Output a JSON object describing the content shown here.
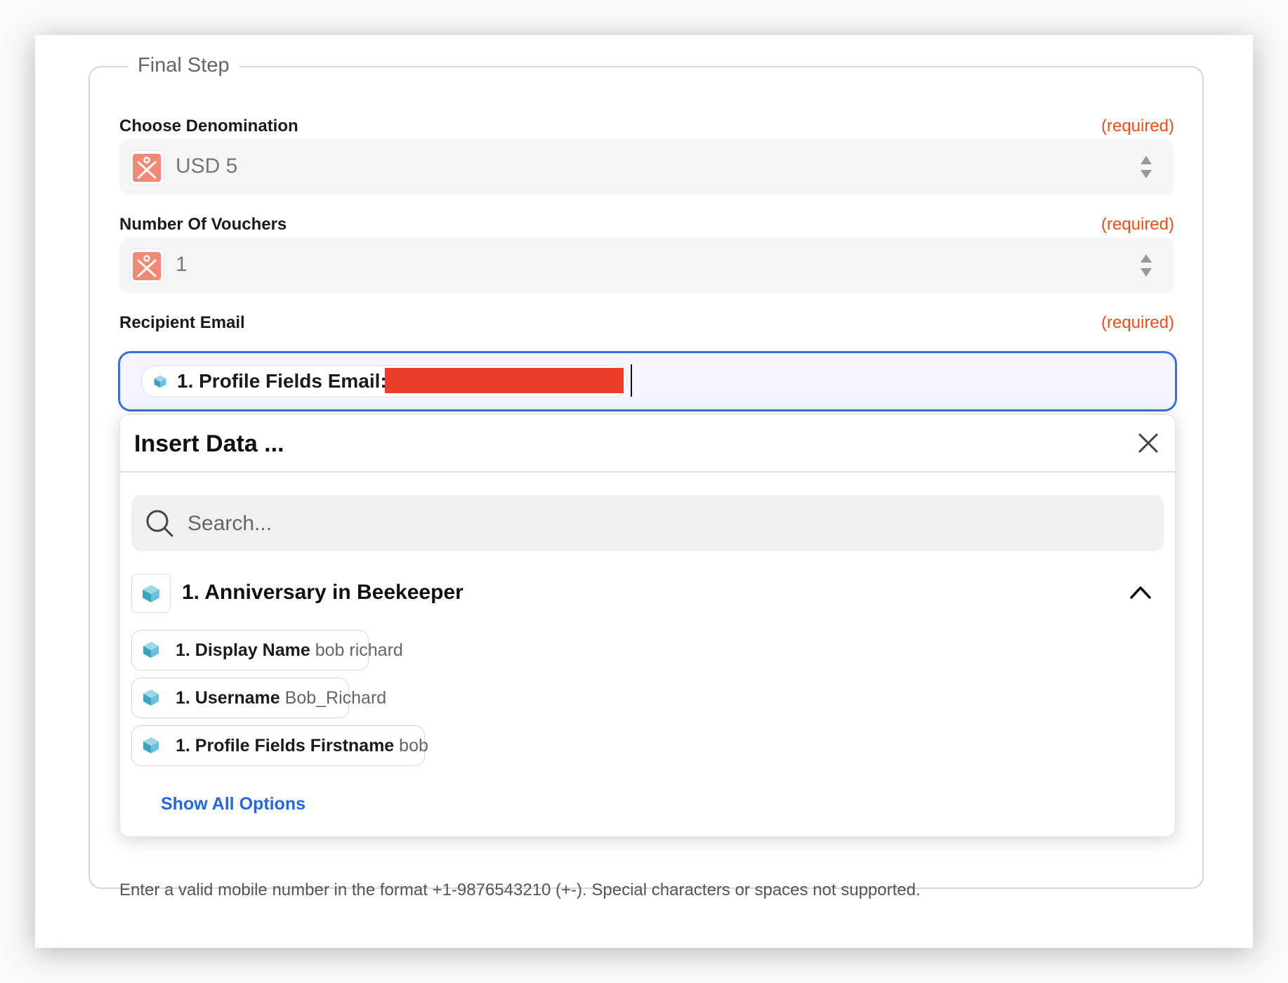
{
  "section": {
    "legend": "Final Step"
  },
  "fields": {
    "denomination": {
      "label": "Choose Denomination",
      "required": "(required)",
      "value": "USD 5"
    },
    "vouchers": {
      "label": "Number Of Vouchers",
      "required": "(required)",
      "value": "1"
    },
    "email": {
      "label": "Recipient Email",
      "required": "(required)",
      "pill_label": "1. Profile Fields Email:"
    }
  },
  "insert_data": {
    "title": "Insert Data ...",
    "search_placeholder": "Search...",
    "group_title": "1. Anniversary in Beekeeper",
    "options": [
      {
        "name": "1. Display Name",
        "value": "bob richard"
      },
      {
        "name": "1. Username",
        "value": "Bob_Richard"
      },
      {
        "name": "1. Profile Fields Firstname",
        "value": "bob"
      }
    ],
    "show_all": "Show All Options"
  },
  "help_text": "Enter a valid mobile number in the format +1-9876543210 (+-). Special characters or spaces not supported.",
  "colors": {
    "accent": "#3d6ee0",
    "required": "#e8501f",
    "link": "#2467e0",
    "redaction": "#ec3d2a"
  }
}
